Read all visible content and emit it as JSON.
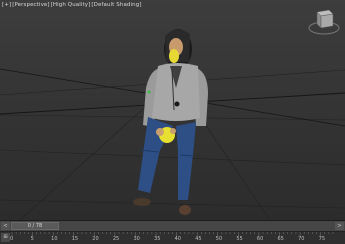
{
  "viewport": {
    "labels": [
      "[+]",
      "[Perspective]",
      "[High Quality]",
      "[Default Shading]"
    ]
  },
  "timeline": {
    "slider_text": "0 / 78",
    "ticks": [
      "0",
      "5",
      "10",
      "15",
      "20",
      "25",
      "30",
      "35",
      "40",
      "45",
      "50",
      "55",
      "60",
      "65",
      "70",
      "75"
    ]
  },
  "colors": {
    "background": "#333333",
    "grid": "#1e1e1e",
    "shirt": "#a7a7a7",
    "jeans": "#2d4f86",
    "selection": "#e8e030"
  },
  "icons": {
    "viewcube": "viewcube-icon",
    "prev": "prev-frame-icon",
    "next": "next-frame-icon"
  }
}
